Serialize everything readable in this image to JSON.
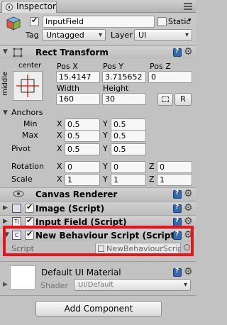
{
  "tab": {
    "title": "Inspector"
  },
  "object": {
    "name": "InputField",
    "static_label": "Static",
    "tag_label": "Tag",
    "tag_value": "Untagged",
    "layer_label": "Layer",
    "layer_value": "UI"
  },
  "rect_transform": {
    "title": "Rect Transform",
    "anchor_h": "center",
    "anchor_v": "middle",
    "headers": {
      "posx": "Pos X",
      "posy": "Pos Y",
      "posz": "Pos Z",
      "width": "Width",
      "height": "Height"
    },
    "posx": "15.4147",
    "posy": "3.715652",
    "posz": "0",
    "width": "160",
    "height": "30",
    "r_button": "R",
    "anchors_label": "Anchors",
    "min_label": "Min",
    "max_label": "Max",
    "pivot_label": "Pivot",
    "rotation_label": "Rotation",
    "scale_label": "Scale",
    "x": "X",
    "y": "Y",
    "z": "Z",
    "min": {
      "x": "0.5",
      "y": "0.5"
    },
    "max": {
      "x": "0.5",
      "y": "0.5"
    },
    "pivot": {
      "x": "0.5",
      "y": "0.5"
    },
    "rotation": {
      "x": "0",
      "y": "0",
      "z": "0"
    },
    "scale": {
      "x": "1",
      "y": "1",
      "z": "1"
    }
  },
  "components": {
    "canvas_renderer": "Canvas Renderer",
    "image": "Image (Script)",
    "input_field": "Input Field (Script)",
    "new_behaviour": "New Behaviour Script (Script)",
    "script_label": "Script",
    "script_value": "NewBehaviourScrip"
  },
  "material": {
    "name": "Default UI Material",
    "shader_label": "Shader",
    "shader_value": "UI/Default"
  },
  "add_component": "Add Component"
}
